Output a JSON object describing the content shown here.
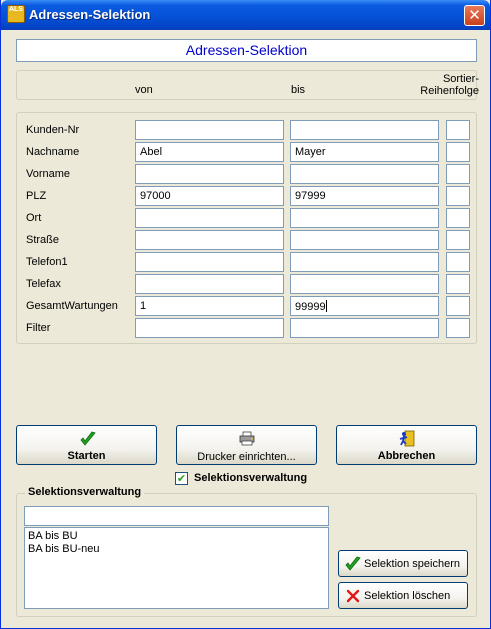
{
  "window": {
    "title": "Adressen-Selektion",
    "close_glyph": "✕",
    "app_icon": "ALS"
  },
  "header": {
    "title": "Adressen-Selektion"
  },
  "columns": {
    "von": "von",
    "bis": "bis",
    "sort_line1": "Sortier-",
    "sort_line2": "Reihenfolge"
  },
  "fields": [
    {
      "label": "Kunden-Nr",
      "von": "",
      "bis": "",
      "sort": ""
    },
    {
      "label": "Nachname",
      "von": "Abel",
      "bis": "Mayer",
      "sort": ""
    },
    {
      "label": "Vorname",
      "von": "",
      "bis": "",
      "sort": ""
    },
    {
      "label": "PLZ",
      "von": "97000",
      "bis": "97999",
      "sort": ""
    },
    {
      "label": "Ort",
      "von": "",
      "bis": "",
      "sort": ""
    },
    {
      "label": "Straße",
      "von": "",
      "bis": "",
      "sort": ""
    },
    {
      "label": "Telefon1",
      "von": "",
      "bis": "",
      "sort": ""
    },
    {
      "label": "Telefax",
      "von": "",
      "bis": "",
      "sort": ""
    },
    {
      "label": "GesamtWartungen",
      "von": "1",
      "bis": "99999",
      "sort": ""
    },
    {
      "label": "Filter",
      "von": "",
      "bis": "",
      "sort": ""
    }
  ],
  "buttons": {
    "start": "Starten",
    "printer": "Drucker einrichten...",
    "cancel": "Abbrechen",
    "save_selection": "Selektion speichern",
    "delete_selection": "Selektion löschen"
  },
  "checkbox": {
    "label": "Selektionsverwaltung",
    "checked": true,
    "glyph": "✔"
  },
  "selection_group": {
    "title": "Selektionsverwaltung",
    "input_value": "",
    "items": [
      "BA bis BU",
      "BA bis BU-neu"
    ]
  },
  "colors": {
    "accent": "#0000cc",
    "check_green": "#21a121",
    "delete_red": "#e01818",
    "titlebar": "#0553d8"
  },
  "icons": {
    "start": "green-checkmark-icon",
    "printer": "printer-icon",
    "cancel": "exit-door-icon",
    "save": "green-checkmark-icon",
    "delete": "red-x-icon"
  }
}
